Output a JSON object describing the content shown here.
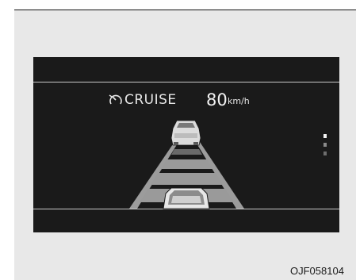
{
  "cruise": {
    "label": "CRUISE",
    "icon": "cruise-control-icon",
    "speed_value": "80",
    "speed_unit": "km/h"
  },
  "lane_indicator": {
    "active_level": 1,
    "total_levels": 3
  },
  "colors": {
    "display_background": "#1a1a1a",
    "frame_background": "#e8e8e8",
    "text": "#e6e6e6",
    "road_band": "#9c9c9c"
  },
  "caption": "OJF058104"
}
